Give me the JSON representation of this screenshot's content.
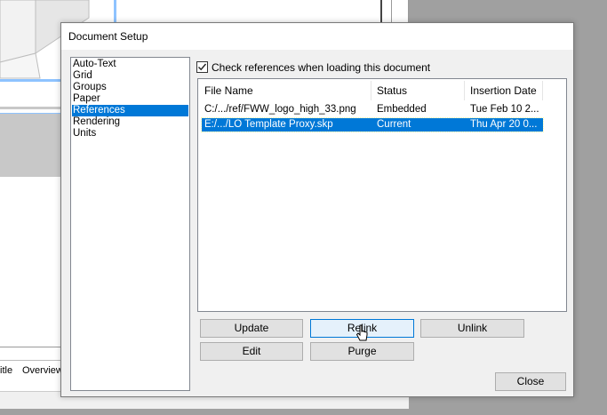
{
  "background_app": {
    "tabs": [
      "itle",
      "Overview"
    ]
  },
  "dialog": {
    "title": "Document Setup",
    "sidebar_items": [
      {
        "label": "Auto-Text",
        "selected": false
      },
      {
        "label": "Grid",
        "selected": false
      },
      {
        "label": "Groups",
        "selected": false
      },
      {
        "label": "Paper",
        "selected": false
      },
      {
        "label": "References",
        "selected": true
      },
      {
        "label": "Rendering",
        "selected": false
      },
      {
        "label": "Units",
        "selected": false
      }
    ],
    "check_references": {
      "label": "Check references when loading this document",
      "checked": true
    },
    "table": {
      "columns": [
        "File Name",
        "Status",
        "Insertion Date"
      ],
      "rows": [
        {
          "file": "C:/.../ref/FWW_logo_high_33.png",
          "status": "Embedded",
          "date": "Tue Feb 10 2...",
          "selected": false
        },
        {
          "file": "E:/.../LO Template Proxy.skp",
          "status": "Current",
          "date": "Thu Apr 20 0...",
          "selected": true
        }
      ]
    },
    "buttons": {
      "update": "Update",
      "relink": "Relink",
      "unlink": "Unlink",
      "edit": "Edit",
      "purge": "Purge",
      "close": "Close"
    }
  },
  "colors": {
    "selection": "#0078d7",
    "guide_blue": "#8ec3ff"
  }
}
